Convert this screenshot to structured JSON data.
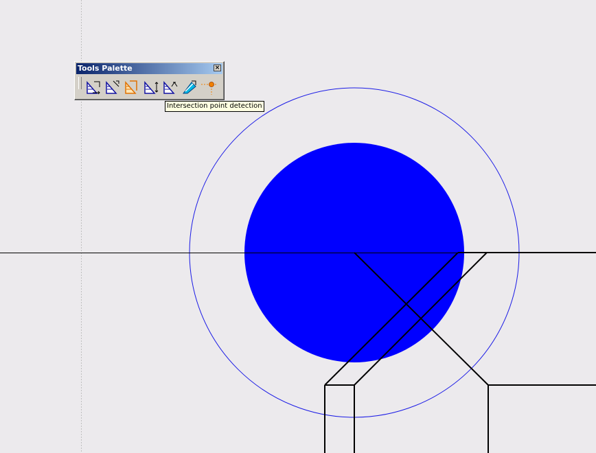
{
  "palette": {
    "title": "Tools Palette",
    "close_glyph": "×",
    "tools": [
      {
        "icon": "grid-snap-icon"
      },
      {
        "icon": "construction-element-icon"
      },
      {
        "icon": "geometric-constraints-icon"
      },
      {
        "icon": "dimensional-constraints-icon"
      },
      {
        "icon": "auto-constraint-icon"
      },
      {
        "icon": "cutting-element-icon"
      },
      {
        "icon": "intersection-point-detection-icon"
      }
    ]
  },
  "tooltip": {
    "text": "Intersection point detection"
  },
  "colors": {
    "background": "#ECEAED",
    "filled_circle": "#0000FF",
    "outline_circle": "#1A1AE6",
    "geometry_lines": "#000000",
    "axis_dotted": "#BFBFBF"
  }
}
